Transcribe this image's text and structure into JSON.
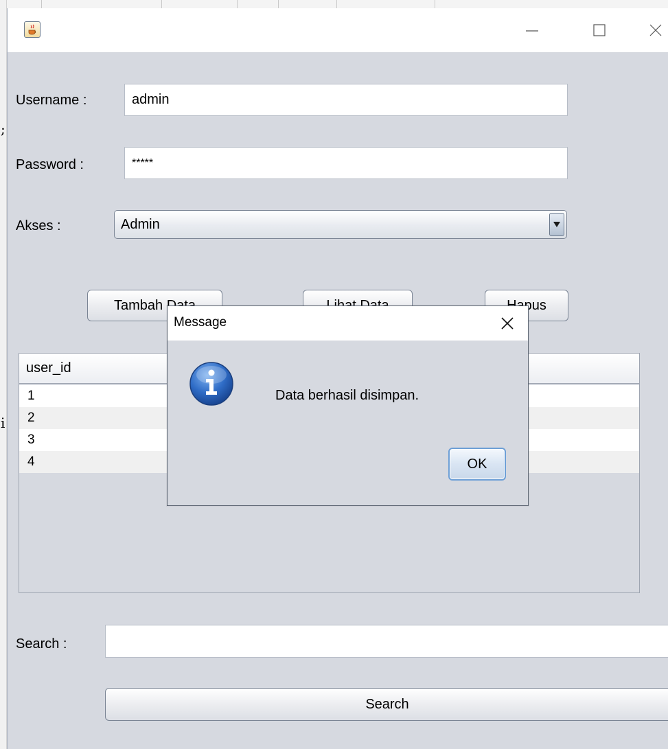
{
  "form": {
    "username_label": "Username :",
    "username_value": "admin",
    "password_label": "Password :",
    "password_value": "*****",
    "akses_label": "Akses :",
    "akses_selected": "Admin",
    "tambah_label": "Tambah Data",
    "lihat_label": "Lihat Data",
    "hapus_label": "Hapus",
    "search_label": "Search :",
    "search_value": "",
    "search_button": "Search"
  },
  "table": {
    "columns": [
      "user_id"
    ],
    "rows": [
      "1",
      "2",
      "3",
      "4"
    ]
  },
  "dialog": {
    "title": "Message",
    "message": "Data berhasil disimpan.",
    "ok_label": "OK"
  },
  "background": {
    "left_marks": [
      ";",
      "i"
    ]
  },
  "colors": {
    "window_bg": "#d6d9e0",
    "info_icon_blue": "#2b63b8",
    "ok_border": "#6d9fd6"
  },
  "icons": {
    "app": "java-cup-icon",
    "info": "information-icon",
    "close": "close-icon",
    "minimize": "minimize-icon",
    "maximize": "maximize-icon",
    "dropdown": "triangle-down-icon"
  }
}
